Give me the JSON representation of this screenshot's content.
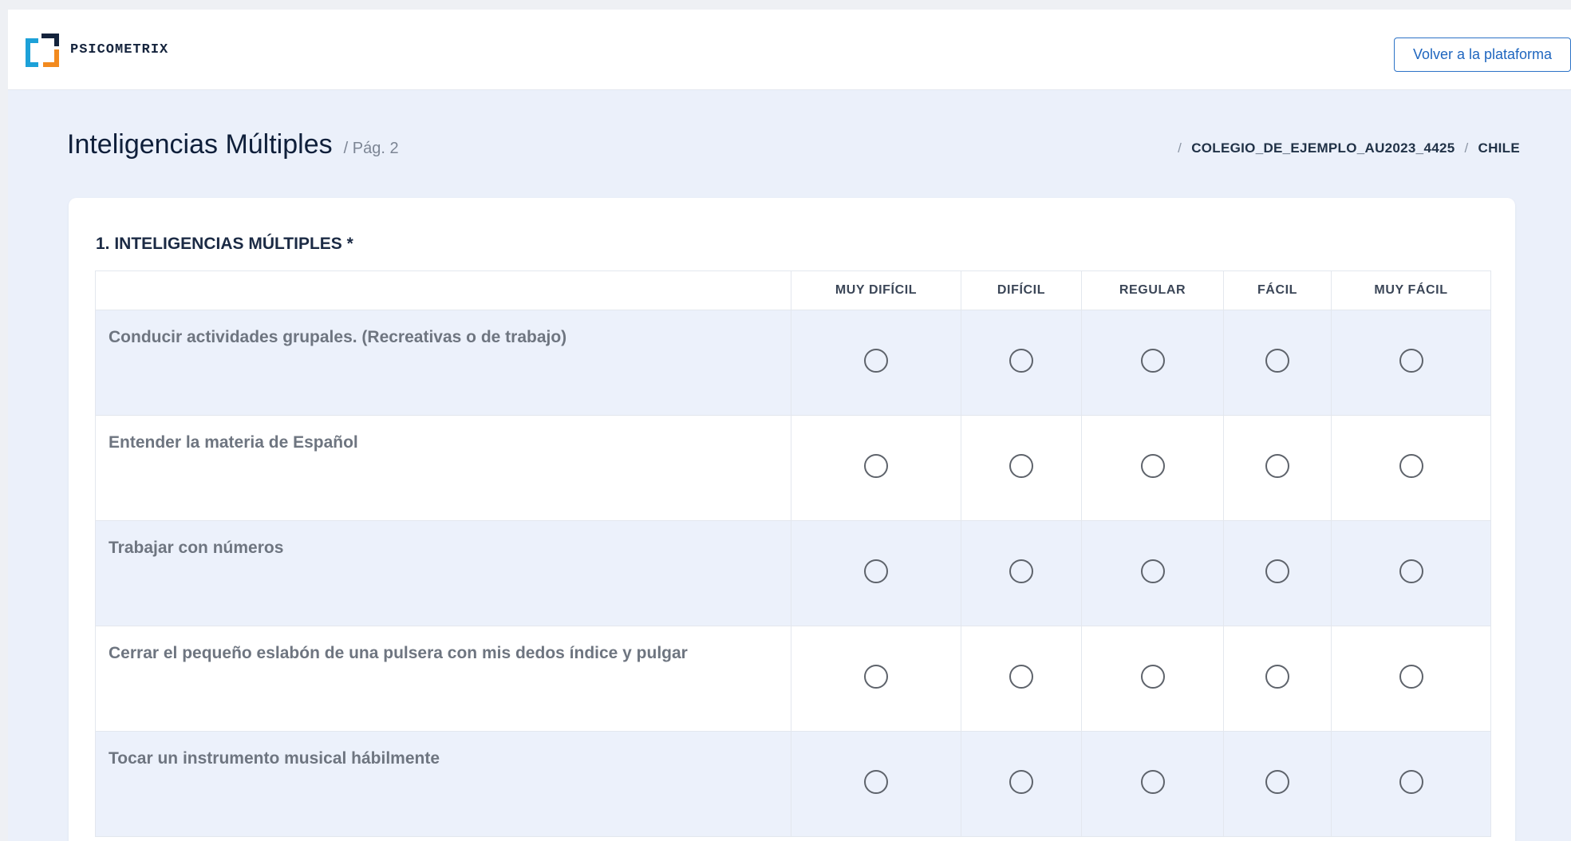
{
  "brand": {
    "name": "PSICOMETRIX"
  },
  "header": {
    "back_button": "Volver a la plataforma"
  },
  "page": {
    "title": "Inteligencias Múltiples",
    "subtitle": "/ Pág. 2",
    "breadcrumb": [
      "COLEGIO_DE_EJEMPLO_AU2023_4425",
      "CHILE"
    ]
  },
  "question": {
    "title": "1. INTELIGENCIAS MÚLTIPLES *",
    "columns": [
      "MUY DIFÍCIL",
      "DIFÍCIL",
      "REGULAR",
      "FÁCIL",
      "MUY FÁCIL"
    ],
    "rows": [
      "Conducir actividades grupales. (Recreativas o de trabajo)",
      "Entender la materia de Español",
      "Trabajar con números",
      "Cerrar el pequeño eslabón de una pulsera con mis dedos índice y pulgar",
      "Tocar un instrumento musical hábilmente"
    ]
  },
  "colors": {
    "accent": "#2d73c7",
    "row_alt": "#ecf1fb",
    "background": "#ebf0fa"
  }
}
